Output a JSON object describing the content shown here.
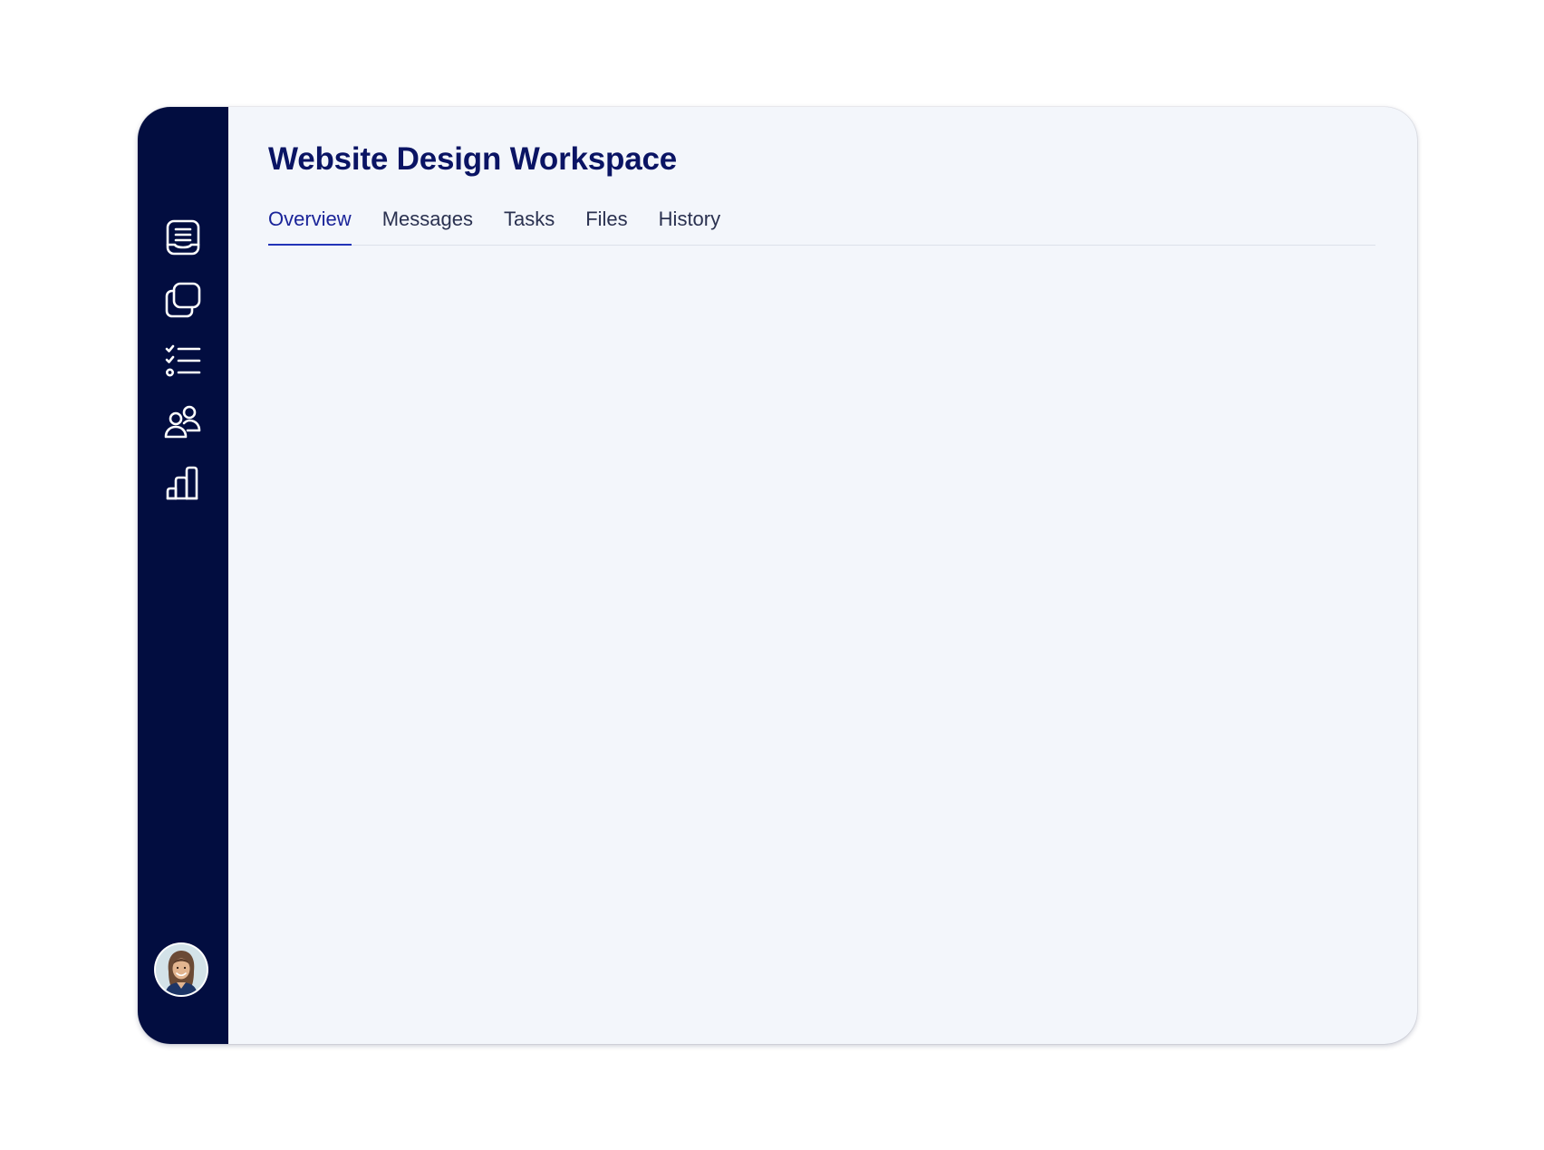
{
  "app": {
    "title": "Website Design Workspace"
  },
  "colors": {
    "sidebar": "#020d40",
    "title": "#0a1464",
    "active_tab": "#1a2499",
    "tab_text": "#2a3150",
    "window_bg": "#f3f6fb"
  },
  "sidebar": {
    "items": [
      {
        "icon": "inbox-document-icon"
      },
      {
        "icon": "stacked-windows-icon"
      },
      {
        "icon": "checklist-icon"
      },
      {
        "icon": "users-icon"
      },
      {
        "icon": "bar-chart-icon"
      }
    ],
    "avatar_icon": "user-avatar"
  },
  "tabs": [
    {
      "label": "Overview",
      "active": true
    },
    {
      "label": "Messages",
      "active": false
    },
    {
      "label": "Tasks",
      "active": false
    },
    {
      "label": "Files",
      "active": false
    },
    {
      "label": "History",
      "active": false
    }
  ]
}
